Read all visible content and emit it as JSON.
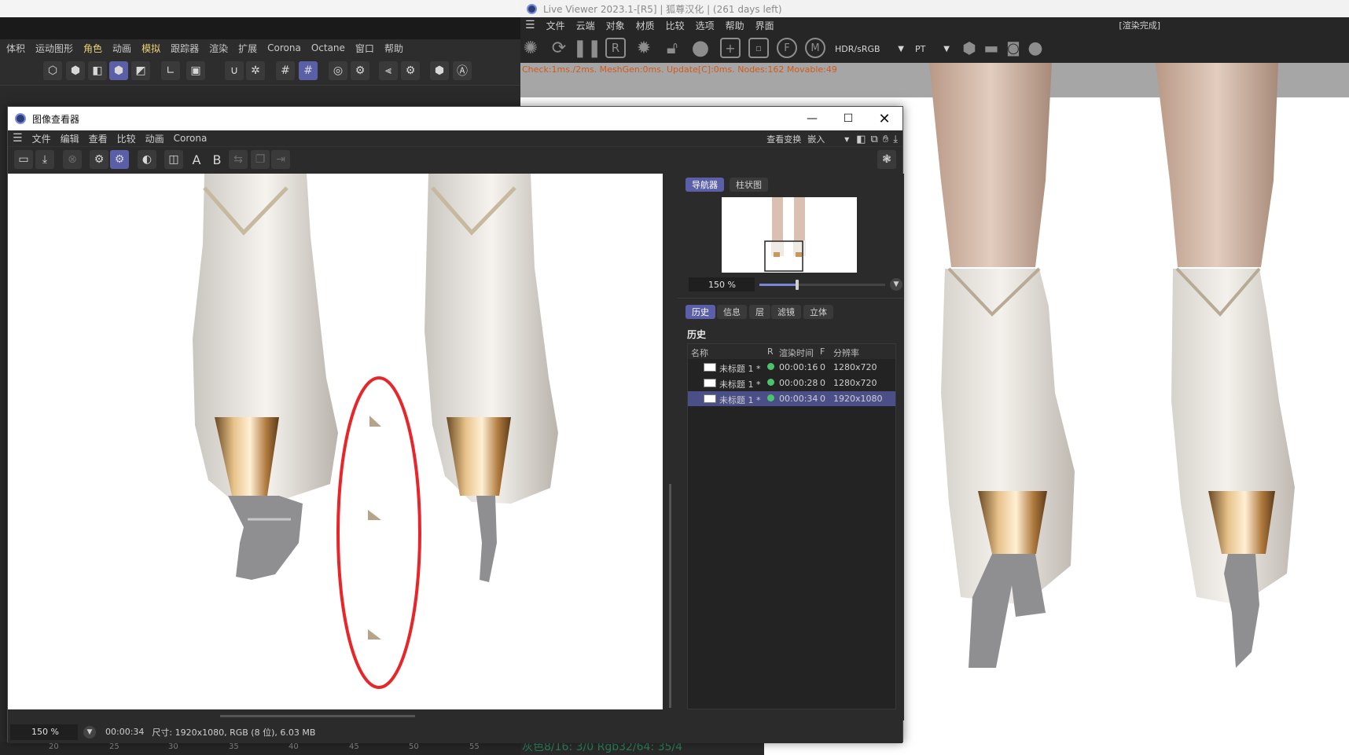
{
  "c4d": {
    "menu": [
      "体积",
      "运动图形",
      "角色",
      "动画",
      "模拟",
      "跟踪器",
      "渲染",
      "扩展",
      "Corona",
      "Octane",
      "窗口",
      "帮助"
    ],
    "ruler_ticks": [
      "20",
      "25",
      "30",
      "35",
      "40",
      "45",
      "50",
      "55"
    ]
  },
  "live_viewer": {
    "title": "Live Viewer 2023.1-[R5] | 狐尊汉化 |  (261 days left)",
    "menu": [
      "文件",
      "云端",
      "对象",
      "材质",
      "比较",
      "选项",
      "帮助",
      "界面"
    ],
    "status": "[渲染完成]",
    "tonemap_select": "HDR/sRGB",
    "engine_select": "PT",
    "check_line": "Check:1ms./2ms. MeshGen:0ms. Update[C]:0ms. Nodes:162 Movable:49",
    "bottom_readout": "灰色8/16: 3/0        Rgb32/64: 35/4"
  },
  "image_viewer": {
    "title": "图像查看器",
    "menu": [
      "文件",
      "编辑",
      "查看",
      "比较",
      "动画",
      "Corona"
    ],
    "view_transform_label": "查看变换",
    "view_transform_value": "嵌入",
    "toolbar_letters": {
      "a": "A",
      "b": "B"
    },
    "zoom": "150 %",
    "render_time": "00:00:34",
    "size_info": "尺寸: 1920x1080, RGB (8 位), 6.03 MB",
    "panel": {
      "top_tabs": [
        "导航器",
        "柱状图"
      ],
      "nav_zoom": "150 %",
      "nav_zoom_fraction": 0.3,
      "sub_tabs": [
        "历史",
        "信息",
        "层",
        "滤镜",
        "立体"
      ],
      "history_title": "历史",
      "columns": {
        "name": "名称",
        "r": "R",
        "time": "渲染时间",
        "f": "F",
        "res": "分辨率"
      },
      "rows": [
        {
          "name": "未标题 1 *",
          "time": "00:00:16",
          "f": "0",
          "res": "1280x720",
          "status_color": "#4bc36b"
        },
        {
          "name": "未标题 1 *",
          "time": "00:00:28",
          "f": "0",
          "res": "1280x720",
          "status_color": "#4bc36b"
        },
        {
          "name": "未标题 1 *",
          "time": "00:00:34",
          "f": "0",
          "res": "1920x1080",
          "status_color": "#4bc36b"
        }
      ]
    }
  },
  "colors": {
    "accent": "#5a5fa8",
    "annotation_ellipse": "#e8262a",
    "error_text": "#d35a1a"
  }
}
